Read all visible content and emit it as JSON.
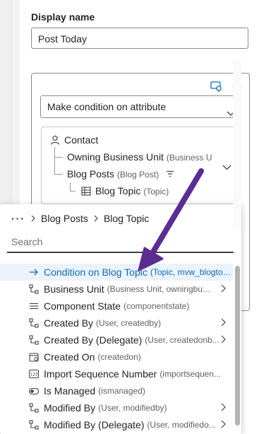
{
  "display_name": {
    "label": "Display name",
    "value": "Post Today"
  },
  "condition": {
    "select_value": "Make condition on attribute"
  },
  "tree": {
    "root": "Contact",
    "owning": {
      "name": "Owning Business Unit",
      "detail": "(Business U"
    },
    "blogposts": {
      "name": "Blog Posts",
      "detail": "(Blog Post)"
    },
    "topic": {
      "name": "Blog Topic",
      "detail": "(Topic)"
    }
  },
  "popup": {
    "crumbs": [
      "Blog Posts",
      "Blog Topic"
    ],
    "search_placeholder": "Search",
    "items": [
      {
        "name": "Condition on Blog Topic",
        "detail": "(Topic, mvw_blogtopic)",
        "icon": "arrow-right-icon"
      },
      {
        "name": "Business Unit",
        "detail": "(Business Unit, owningbusi...",
        "icon": "relationship-icon"
      },
      {
        "name": "Component State",
        "detail": "(componentstate)",
        "icon": "list-icon"
      },
      {
        "name": "Created By",
        "detail": "(User, createdby)",
        "icon": "relationship-icon"
      },
      {
        "name": "Created By (Delegate)",
        "detail": "(User, createdonb...",
        "icon": "relationship-icon"
      },
      {
        "name": "Created On",
        "detail": "(createdon)",
        "icon": "calendar-icon"
      },
      {
        "name": "Import Sequence Number",
        "detail": "(importsequen...",
        "icon": "number-icon"
      },
      {
        "name": "Is Managed",
        "detail": "(ismanaged)",
        "icon": "toggle-icon"
      },
      {
        "name": "Modified By",
        "detail": "(User, modifiedby)",
        "icon": "relationship-icon"
      },
      {
        "name": "Modified By (Delegate)",
        "detail": "(User, modifiedo...",
        "icon": "relationship-icon"
      }
    ]
  },
  "colors": {
    "accent": "#0f6cbd",
    "annotation_arrow": "#5c2d91",
    "highlight": "#ebf3fc"
  }
}
